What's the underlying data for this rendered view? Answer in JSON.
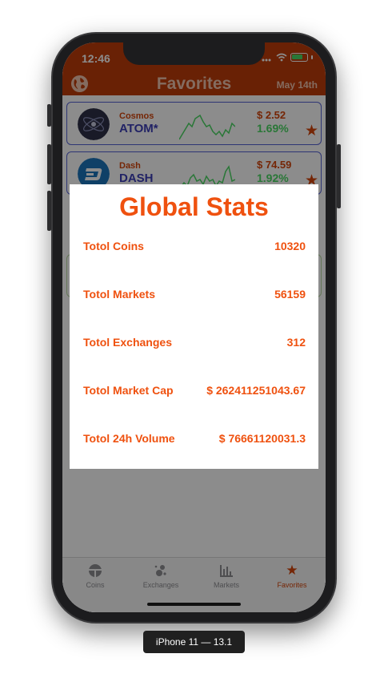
{
  "status_bar": {
    "time": "12:46"
  },
  "header": {
    "title": "Favorites",
    "date": "May 14th",
    "globe_icon": "globe-icon"
  },
  "coins": [
    {
      "name": "Cosmos",
      "symbol": "ATOM*",
      "price": "$ 2.52",
      "change": "1.69%",
      "icon": "cosmos-logo-icon",
      "favorited": true
    },
    {
      "name": "Dash",
      "symbol": "DASH",
      "price": "$ 74.59",
      "change": "1.92%",
      "icon": "dash-logo-icon",
      "favorited": true
    }
  ],
  "global_stats": {
    "title": "Global Stats",
    "rows": [
      {
        "label": "Totol Coins",
        "value": "10320"
      },
      {
        "label": "Totol Markets",
        "value": "56159"
      },
      {
        "label": "Totol Exchanges",
        "value": "312"
      },
      {
        "label": "Totol Market Cap",
        "value": "$ 262411251043.67"
      },
      {
        "label": "Totol 24h Volume",
        "value": "$ 76661120031.3"
      }
    ]
  },
  "tabs": [
    {
      "label": "Coins",
      "icon": "coins-icon",
      "active": false
    },
    {
      "label": "Exchanges",
      "icon": "exchanges-icon",
      "active": false
    },
    {
      "label": "Markets",
      "icon": "markets-chart-icon",
      "active": false
    },
    {
      "label": "Favorites",
      "icon": "star-icon",
      "active": true
    }
  ],
  "device_caption": "iPhone 11 — 13.1",
  "colors": {
    "header_bg": "#bf3d0a",
    "accent_orange": "#ef510f",
    "positive_green": "#4cd964",
    "symbol_blue": "#3c3fb8"
  }
}
